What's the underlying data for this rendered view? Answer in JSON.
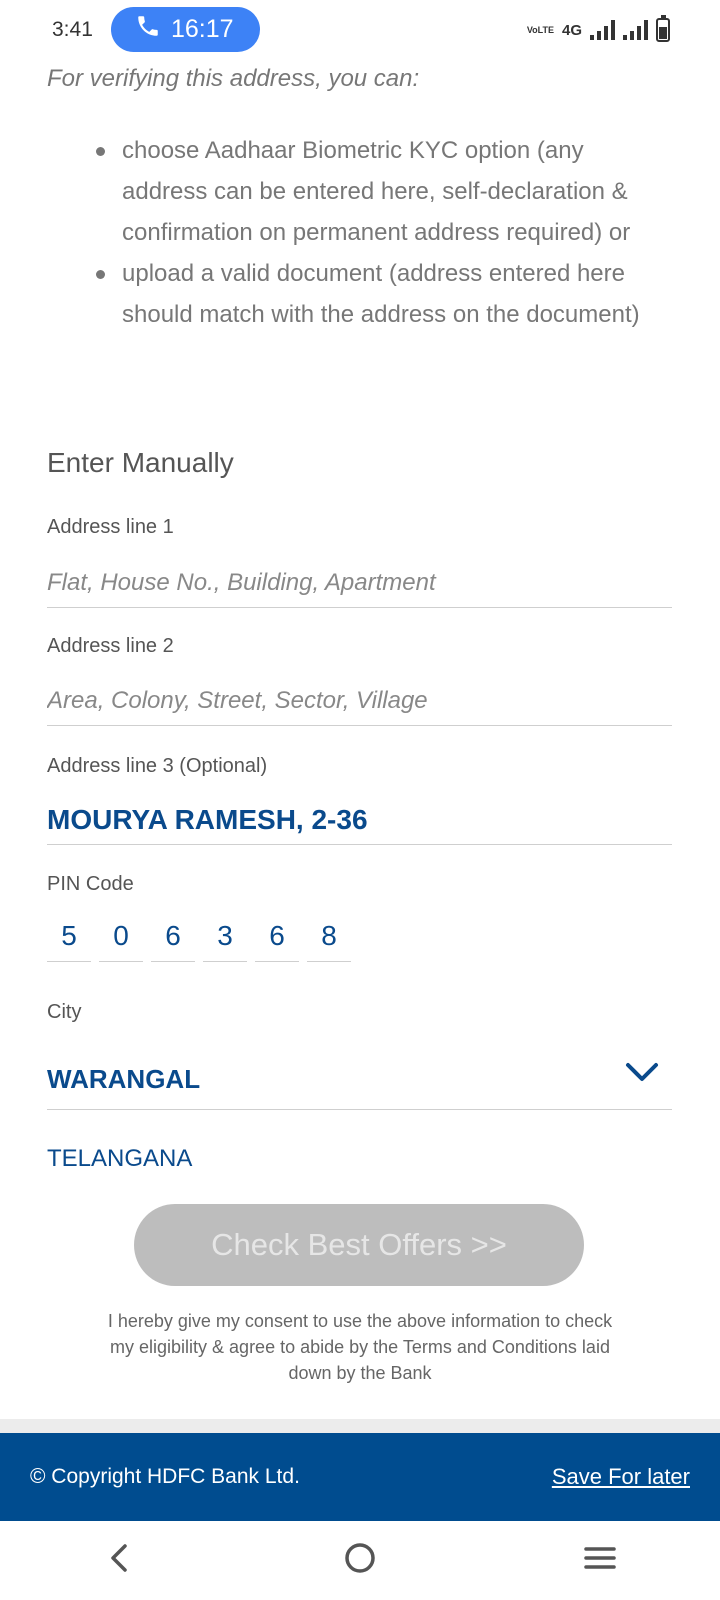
{
  "status_bar": {
    "time": "3:41",
    "call_timer": "16:17",
    "volte_label": "VoLTE",
    "network": "4G"
  },
  "intro": {
    "heading": "For verifying this address, you can:",
    "bullets": [
      "choose Aadhaar Biometric KYC option (any address can be entered here, self-declaration & confirmation on permanent address required) or",
      "upload a valid document (address entered here should match with the address on the document)"
    ]
  },
  "form": {
    "section_title": "Enter Manually",
    "address_line_1": {
      "label": "Address line 1",
      "placeholder": "Flat, House No., Building, Apartment",
      "value": ""
    },
    "address_line_2": {
      "label": "Address line 2",
      "placeholder": "Area, Colony, Street, Sector, Village",
      "value": ""
    },
    "address_line_3": {
      "label": "Address line 3 (Optional)",
      "value": "MOURYA RAMESH, 2-36"
    },
    "pin": {
      "label": "PIN Code",
      "digits": [
        "5",
        "0",
        "6",
        "3",
        "6",
        "8"
      ]
    },
    "city": {
      "label": "City",
      "selected": "WARANGAL"
    },
    "state": "TELANGANA",
    "submit_label": "Check Best Offers >>",
    "consent": "I hereby give my consent to use the above information to check my eligibility & agree to abide by the Terms and Conditions laid down by the Bank"
  },
  "footer": {
    "copyright": "© Copyright HDFC Bank Ltd.",
    "save_link": "Save For later"
  },
  "colors": {
    "brand_blue": "#004c8f",
    "value_blue": "#0a4a8c",
    "call_pill": "#3d82f6",
    "disabled_button": "#bdbdbd"
  },
  "icons": {
    "call": "phone-icon",
    "city_dropdown": "chevron-down-icon",
    "nav_back": "back-icon",
    "nav_home": "home-icon",
    "nav_recents": "recents-icon"
  }
}
